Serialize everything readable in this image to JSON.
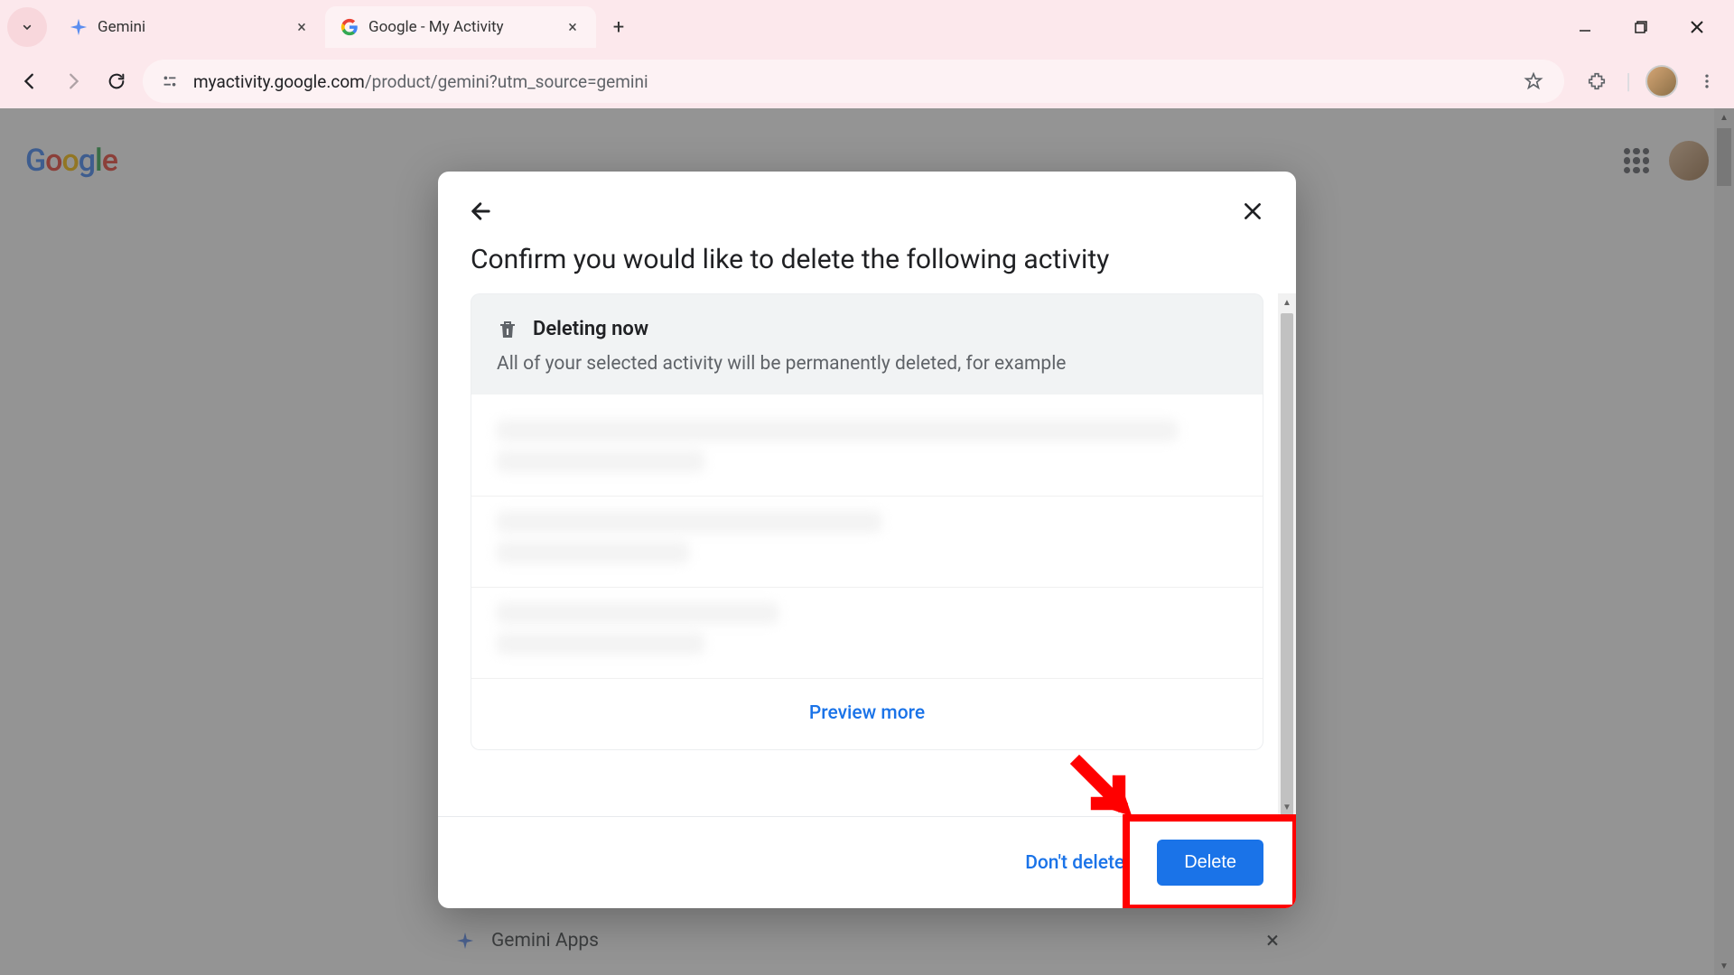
{
  "browser": {
    "tabs": [
      {
        "title": "Gemini",
        "active": false
      },
      {
        "title": "Google - My Activity",
        "active": true
      }
    ],
    "url_host": "myactivity.google.com",
    "url_path": "/product/gemini?utm_source=gemini"
  },
  "page": {
    "logo_letters": [
      "G",
      "o",
      "o",
      "g",
      "l",
      "e"
    ],
    "bottom_label": "Gemini Apps"
  },
  "dialog": {
    "title": "Confirm you would like to delete the following activity",
    "info_title": "Deleting now",
    "info_desc": "All of your selected activity will be permanently deleted, for example",
    "preview_more": "Preview more",
    "dont_delete": "Don't delete",
    "delete": "Delete"
  }
}
